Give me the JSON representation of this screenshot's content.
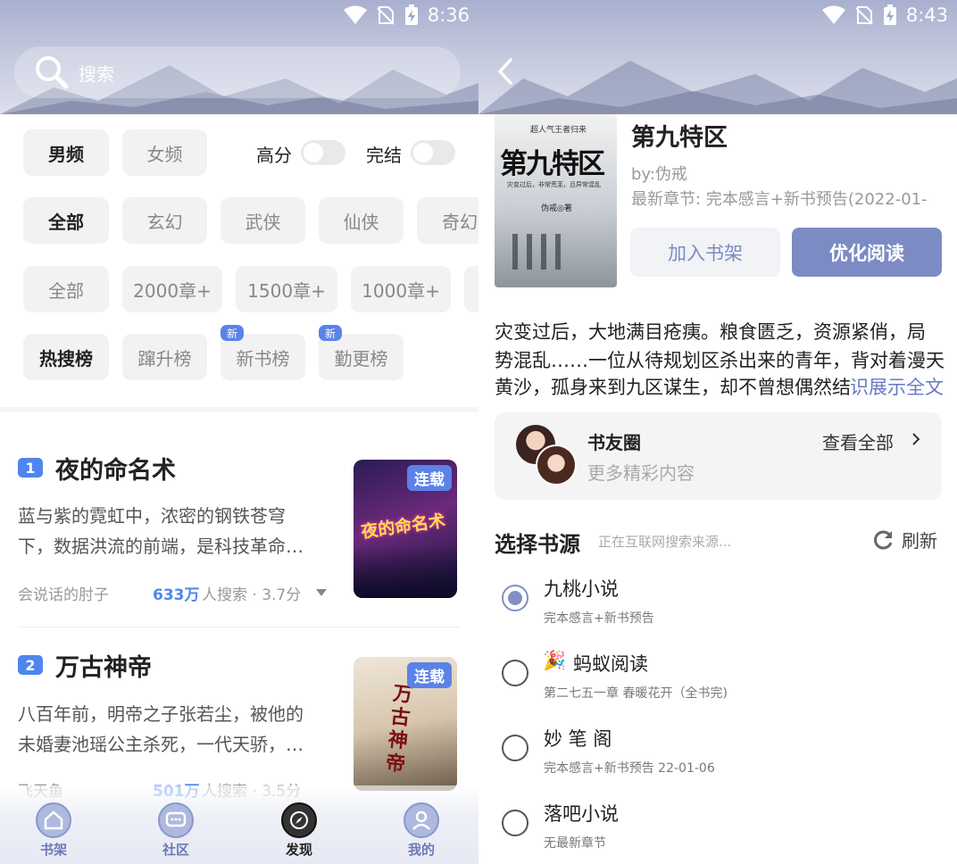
{
  "left": {
    "status": {
      "time": "8:36"
    },
    "search": {
      "placeholder": "搜索"
    },
    "gender_tabs": [
      "男频",
      "女频"
    ],
    "filter_toggles": {
      "high_score": "高分",
      "completed": "完结"
    },
    "genre_tags": [
      "全部",
      "玄幻",
      "武侠",
      "仙侠",
      "奇幻"
    ],
    "chapter_tags": [
      "全部",
      "2000章+",
      "1500章+",
      "1000章+"
    ],
    "rank_tabs": [
      {
        "label": "热搜榜",
        "badge": ""
      },
      {
        "label": "蹿升榜",
        "badge": ""
      },
      {
        "label": "新书榜",
        "badge": "新"
      },
      {
        "label": "勤更榜",
        "badge": "新"
      }
    ],
    "books": [
      {
        "rank": "1",
        "title": "夜的命名术",
        "desc_line1": "蓝与紫的霓虹中，浓密的钢铁苍穹",
        "desc_line2": "下，数据洪流的前端，是科技革命…",
        "author": "会说话的肘子",
        "searches": "633万",
        "meta": "人搜索 · 3.7分",
        "tag": "连载",
        "cover_text": "夜的命名术"
      },
      {
        "rank": "2",
        "title": "万古神帝",
        "desc_line1": "八百年前，明帝之子张若尘，被他的",
        "desc_line2": "未婚妻池瑶公主杀死，一代天骄，…",
        "author": "飞天鱼",
        "searches": "501万",
        "meta": "人搜索 · 3.5分",
        "tag": "连载",
        "cover_text": "万古神帝"
      }
    ],
    "bottom_nav": [
      "书架",
      "社区",
      "发现",
      "我的"
    ]
  },
  "right": {
    "status": {
      "time": "8:43"
    },
    "book": {
      "title": "第九特区",
      "author": "by:伪戒",
      "latest": "最新章节: 完本感言+新书预告(2022-01-",
      "cover_title": "第九特区",
      "cover_top": "超人气王者归来",
      "cover_sub": "灾变过后，非常荒芜，且异常混乱",
      "cover_author": "伪戒◎著"
    },
    "buttons": {
      "add_shelf": "加入书架",
      "read": "优化阅读"
    },
    "intro_line1": "灾变过后，大地满目疮痍。粮食匮乏，资源紧俏，局",
    "intro_line2": "势混乱……一位从待规划区杀出来的青年，背对着漫天",
    "intro_line3": "黄沙，孤身来到九区谋生，却不曾想偶然结",
    "intro_more": "识展示全文",
    "circle": {
      "title": "书友圈",
      "subtitle": "更多精彩内容",
      "view_all": "查看全部"
    },
    "sources": {
      "title": "选择书源",
      "status": "正在互联网搜索来源...",
      "refresh": "刷新",
      "items": [
        {
          "name": "九桃小说",
          "chapter": "完本感言+新书预告",
          "selected": true,
          "emoji": ""
        },
        {
          "name": "蚂蚁阅读",
          "chapter": "第二七五一章 春暖花开（全书完)",
          "selected": false,
          "emoji": "🎉"
        },
        {
          "name": "妙 笔 阁",
          "chapter": "完本感言+新书预告 22-01-06",
          "selected": false,
          "emoji": ""
        },
        {
          "name": "落吧小说",
          "chapter": "无最新章节",
          "selected": false,
          "emoji": ""
        }
      ]
    }
  },
  "colors": {
    "accent": "#7d8bc4",
    "rank_blue": "#4e86ee",
    "link": "#6679c4"
  }
}
